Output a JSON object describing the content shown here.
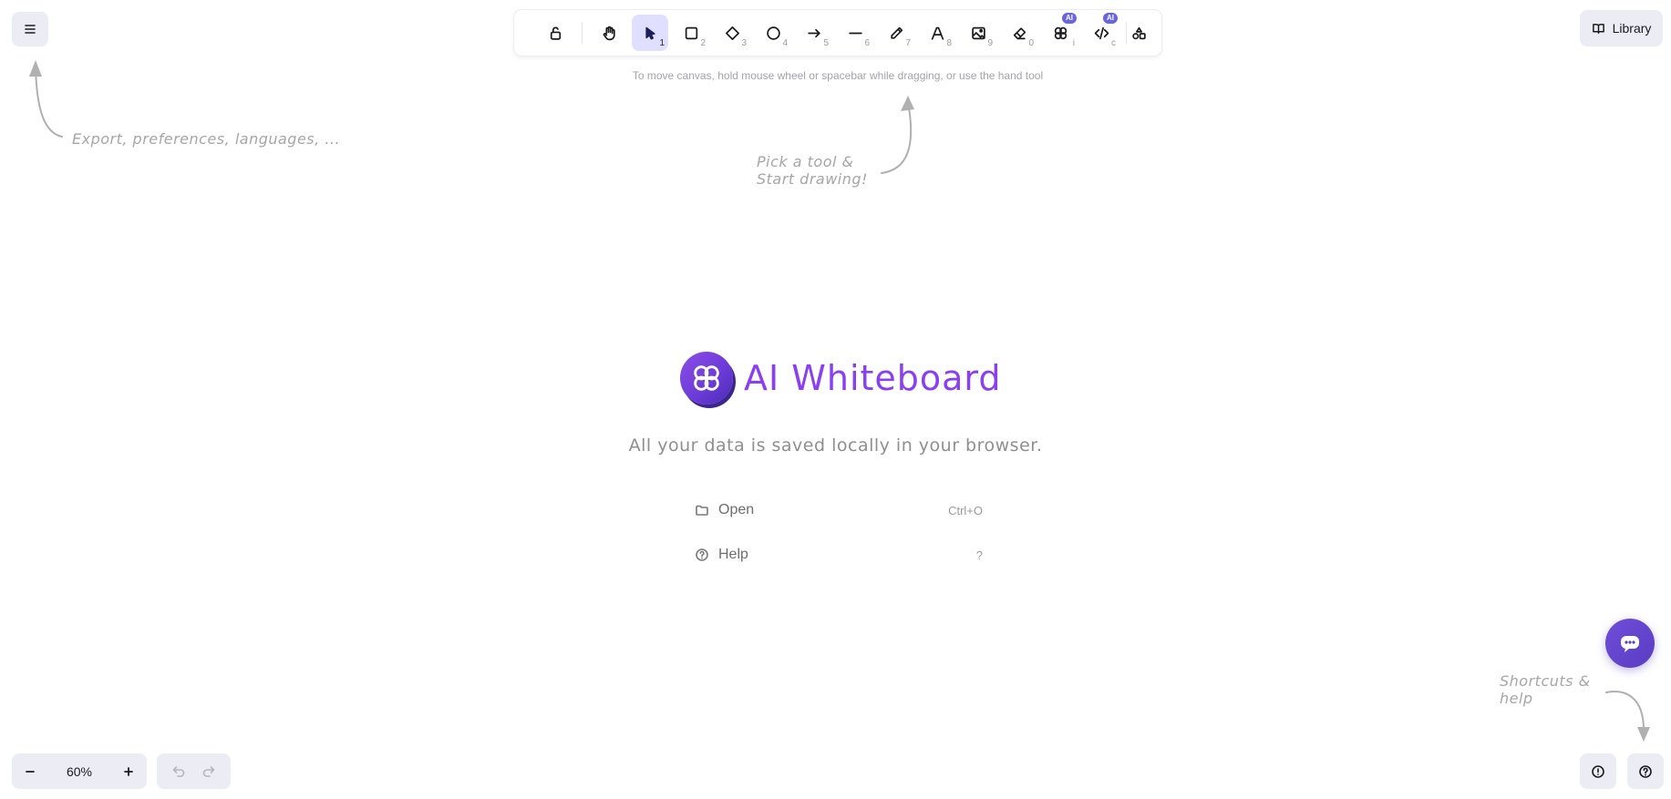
{
  "toolbar": {
    "tools": [
      {
        "name": "lock",
        "key": ""
      },
      {
        "name": "hand",
        "key": ""
      },
      {
        "name": "selection",
        "key": "1"
      },
      {
        "name": "rectangle",
        "key": "2"
      },
      {
        "name": "diamond",
        "key": "3"
      },
      {
        "name": "ellipse",
        "key": "4"
      },
      {
        "name": "arrow",
        "key": "5"
      },
      {
        "name": "line",
        "key": "6"
      },
      {
        "name": "draw",
        "key": "7"
      },
      {
        "name": "text",
        "key": "8"
      },
      {
        "name": "image",
        "key": "9"
      },
      {
        "name": "eraser",
        "key": "0"
      },
      {
        "name": "ai-generate",
        "key": "i",
        "badge": "AI"
      },
      {
        "name": "ai-code",
        "key": "c",
        "badge": "AI"
      },
      {
        "name": "more-tools",
        "key": ""
      }
    ],
    "active_tool": "selection",
    "hint": "To move canvas, hold mouse wheel or spacebar while dragging, or use the hand tool"
  },
  "hints": {
    "menu": "Export, preferences, languages, ...",
    "tool_line1": "Pick a tool &",
    "tool_line2": "Start drawing!",
    "help_line1": "Shortcuts &",
    "help_line2": "help"
  },
  "welcome": {
    "title": "AI Whiteboard",
    "tagline": "All your data is saved locally in your browser.",
    "items": [
      {
        "label": "Open",
        "shortcut": "Ctrl+O",
        "icon": "folder-icon"
      },
      {
        "label": "Help",
        "shortcut": "?",
        "icon": "question-icon"
      }
    ]
  },
  "library": {
    "label": "Library"
  },
  "zoom": {
    "value": "60%"
  },
  "colors": {
    "accent": "#6965db",
    "brand": "#8a3ff0",
    "toolbar_bg": "#ececf4"
  }
}
